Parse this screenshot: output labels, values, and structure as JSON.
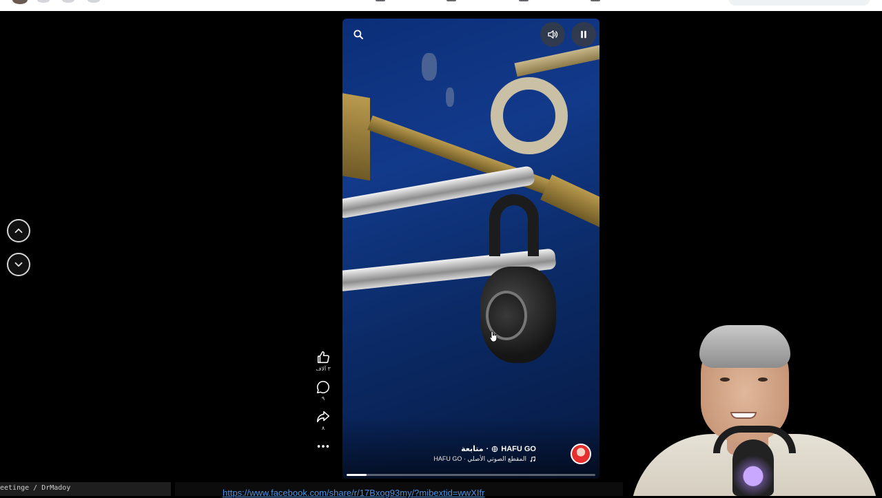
{
  "topbar": {
    "icons": [
      "profile-avatar",
      "messenger-icon",
      "notifications-icon",
      "menu-grid-icon",
      "home-nav-icon",
      "video-nav-icon",
      "marketplace-nav-icon",
      "groups-nav-icon",
      "gaming-nav-icon"
    ]
  },
  "navigation": {
    "prev_icon": "chevron-up-icon",
    "next_icon": "chevron-down-icon"
  },
  "video": {
    "controls": {
      "search_icon": "search-icon",
      "volume_icon": "volume-icon",
      "pause_icon": "pause-icon"
    },
    "progress": 0.08,
    "author": {
      "name": "HAFU GO",
      "separator": "·",
      "follow_label": "متابعة",
      "audio_label": "HAFU GO · المقطع الصوتي الأصلي",
      "globe_icon": "globe-icon",
      "music_icon": "music-note-icon"
    }
  },
  "actions": {
    "like": {
      "icon": "like-icon",
      "count": "٣ آلاف"
    },
    "comment": {
      "icon": "comment-icon",
      "count": "٩"
    },
    "share": {
      "icon": "share-icon",
      "count": "٨"
    },
    "more": {
      "icon": "more-icon"
    }
  },
  "status_bar": {
    "left_text": "eetinge / DrMadoy",
    "url": "https://www.facebook.com/share/r/17Bxog93my/?mibextid=wwXIfr"
  },
  "colors": {
    "link": "#4a90e2",
    "background": "#000000",
    "topbar": "#ffffff"
  }
}
